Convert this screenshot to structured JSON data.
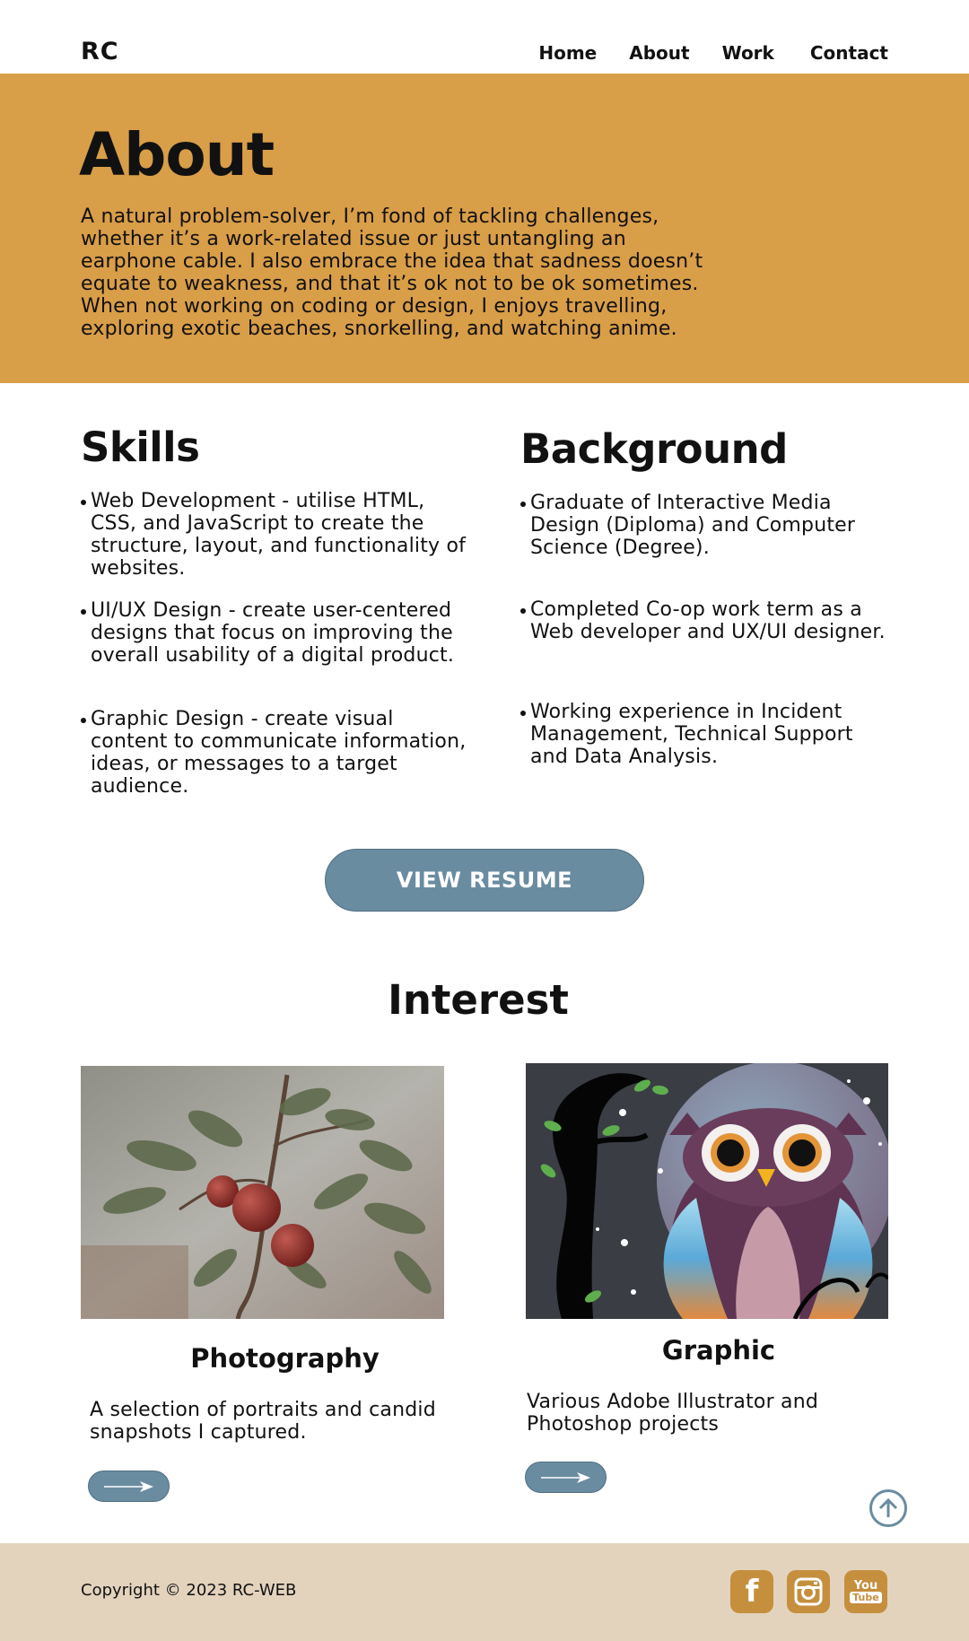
{
  "header": {
    "logo": "RC",
    "nav": [
      {
        "label": "Home"
      },
      {
        "label": "About"
      },
      {
        "label": "Work"
      },
      {
        "label": "Contact"
      }
    ]
  },
  "about": {
    "title": "About",
    "body": "A natural problem-solver, I’m fond of tackling challenges, whether it’s a work-related issue or just untangling an earphone cable. I also embrace the idea that sadness doesn’t equate to weakness, and that it’s ok not to be ok sometimes. When not working on coding or design, I enjoys travelling, exploring exotic beaches, snorkelling, and watching anime."
  },
  "skills": {
    "title": "Skills",
    "items": [
      "Web Development - utilise  HTML, CSS, and JavaScript to create the structure, layout, and functionality of websites.",
      "UI/UX Design - create user-centered designs that focus on improving the overall usability of a digital product.",
      "Graphic Design -  create visual content to communicate information, ideas, or messages to a target audience."
    ]
  },
  "background": {
    "title": "Background",
    "items": [
      "Graduate of Interactive Media Design (Diploma)  and Computer Science (Degree).",
      "Completed Co-op work term as a Web developer and UX/UI designer.",
      "Working experience in Incident Management, Technical Support and Data Analysis."
    ]
  },
  "resume_button": "VIEW RESUME",
  "interest": {
    "title": "Interest",
    "cards": [
      {
        "title": "Photography",
        "description": "A selection of portraits and candid snapshots I captured.",
        "image_icon": "rosehip-branch-photo",
        "button_icon": "arrow-right-icon"
      },
      {
        "title": "Graphic",
        "description": "Various Adobe Illustrator and Photoshop projects",
        "image_icon": "owl-illustration",
        "button_icon": "arrow-right-icon"
      }
    ]
  },
  "back_to_top_icon": "arrow-up-circle-icon",
  "footer": {
    "copyright": "Copyright © 2023 RC-WEB",
    "social": [
      {
        "icon": "facebook-icon",
        "label": "f"
      },
      {
        "icon": "instagram-icon",
        "label": ""
      },
      {
        "icon": "youtube-icon",
        "label_top": "You",
        "label_bottom": "Tube"
      }
    ]
  },
  "colors": {
    "accent_orange": "#d99e48",
    "button_blue": "#6a8ca0",
    "footer_beige": "#e3d3bc",
    "social_gold": "#c58f3e"
  }
}
